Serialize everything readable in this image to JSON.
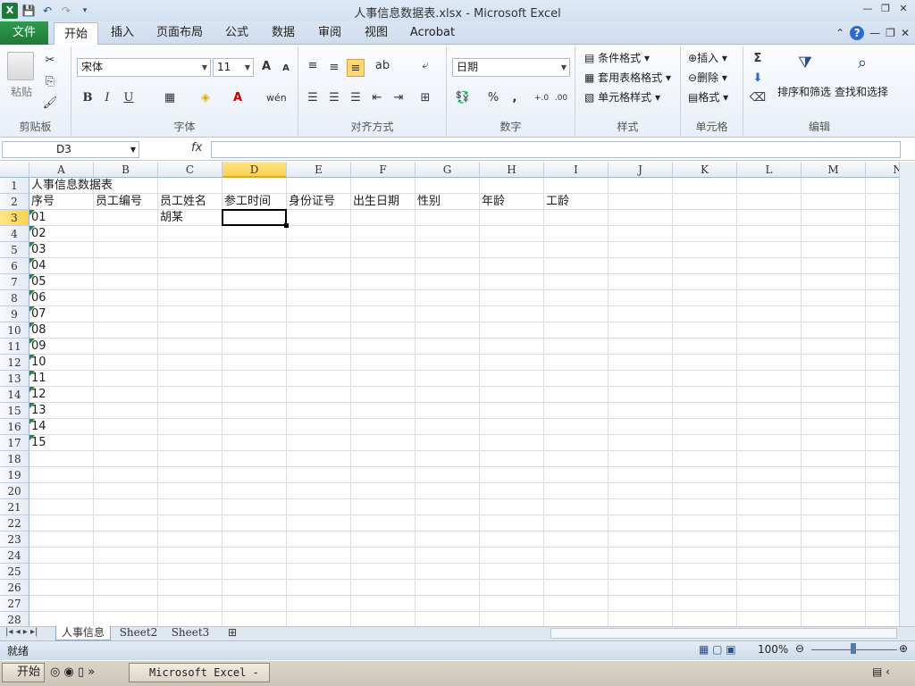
{
  "window": {
    "title": "人事信息数据表.xlsx - Microsoft Excel"
  },
  "ribbon_tabs": {
    "file": "文件",
    "home": "开始",
    "insert": "插入",
    "page_layout": "页面布局",
    "formulas": "公式",
    "data": "数据",
    "review": "审阅",
    "view": "视图",
    "acrobat": "Acrobat"
  },
  "clipboard": {
    "paste": "粘贴",
    "label": "剪贴板"
  },
  "font": {
    "name": "宋体",
    "size": "11",
    "label": "字体",
    "bold": "B",
    "italic": "I",
    "underline": "U",
    "grow": "A",
    "shrink": "A"
  },
  "alignment": {
    "label": "对齐方式"
  },
  "number": {
    "format": "日期",
    "label": "数字",
    "percent": "%",
    "comma": ","
  },
  "styles": {
    "conditional": "条件格式",
    "table": "套用表格格式",
    "cell_styles": "单元格样式",
    "label": "样式"
  },
  "cells": {
    "insert": "插入",
    "delete": "删除",
    "format": "格式",
    "label": "单元格"
  },
  "editing": {
    "sort_filter": "排序和筛选",
    "find_select": "查找和选择",
    "label": "编辑",
    "sigma": "Σ"
  },
  "formula_bar": {
    "name_box": "D3",
    "fx": "fx",
    "value": ""
  },
  "columns": [
    "A",
    "B",
    "C",
    "D",
    "E",
    "F",
    "G",
    "H",
    "I",
    "J",
    "K",
    "L",
    "M",
    "N"
  ],
  "rows": [
    "1",
    "2",
    "3",
    "4",
    "5",
    "6",
    "7",
    "8",
    "9",
    "10",
    "11",
    "12",
    "13",
    "14",
    "15",
    "16",
    "17",
    "18",
    "19",
    "20",
    "21",
    "22",
    "23",
    "24",
    "25",
    "26",
    "27",
    "28"
  ],
  "sheet": {
    "title": "人事信息数据表",
    "headers": [
      "序号",
      "员工编号",
      "员工姓名",
      "参工时间",
      "身份证号",
      "出生日期",
      "性别",
      "年龄",
      "工龄"
    ],
    "employee_name_row3": "胡某",
    "ids": [
      "01",
      "02",
      "03",
      "04",
      "05",
      "06",
      "07",
      "08",
      "09",
      "10",
      "11",
      "12",
      "13",
      "14",
      "15"
    ]
  },
  "sheet_tabs": [
    "人事信息",
    "Sheet2",
    "Sheet3"
  ],
  "status": {
    "ready": "就绪",
    "zoom": "100%"
  },
  "taskbar": {
    "start": "开始",
    "app": "Microsoft Excel - ..."
  }
}
